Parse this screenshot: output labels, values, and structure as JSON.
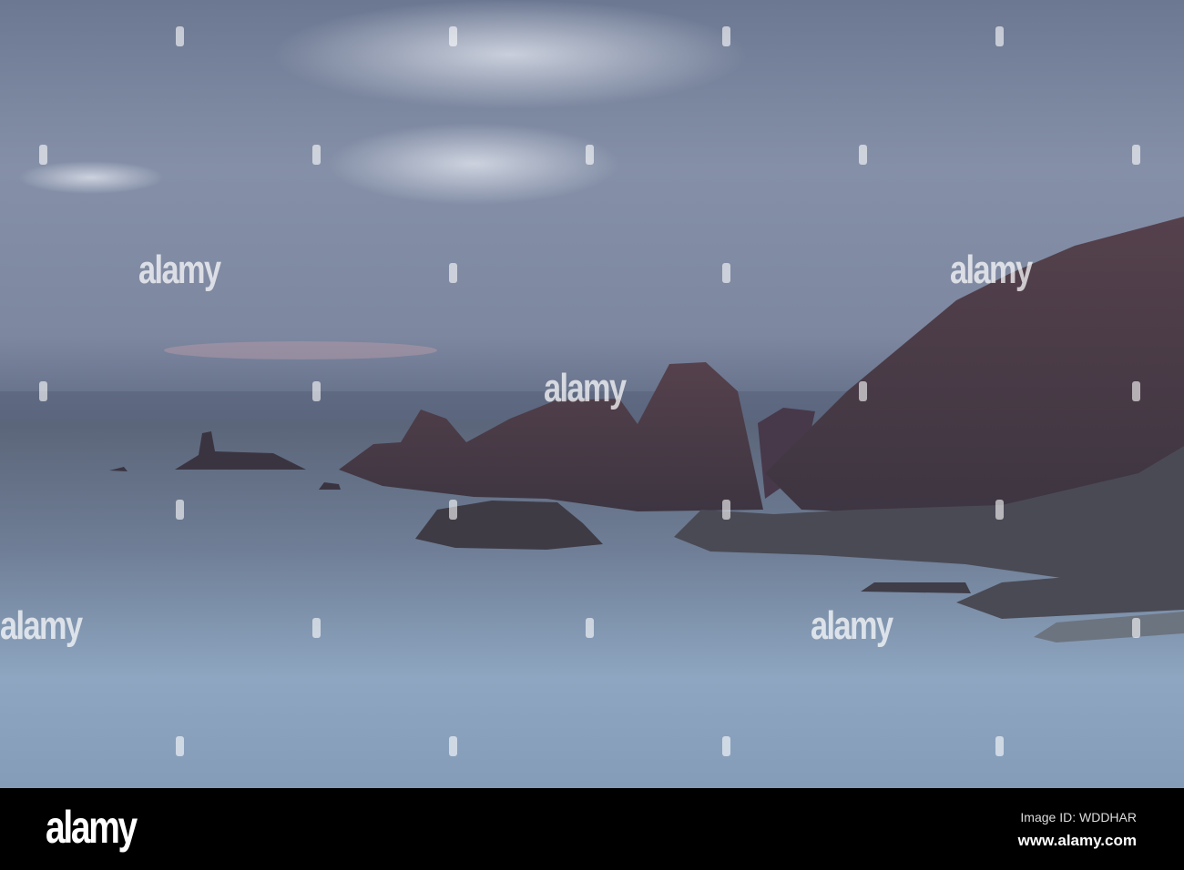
{
  "photo": {
    "subject": "Rocky coastline sea stacks at dusk under overcast sky",
    "colors": {
      "sky": "#6f7b96",
      "water": "#8aa2bd",
      "rock": "#4a3b46"
    }
  },
  "watermark": {
    "text": "alamy"
  },
  "footer": {
    "brand": "alamy",
    "image_id": "Image ID: WDDHAR",
    "website": "www.alamy.com"
  }
}
